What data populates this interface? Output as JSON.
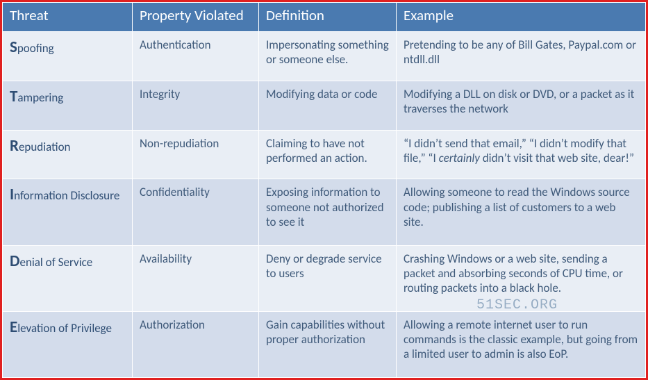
{
  "headers": {
    "threat": "Threat",
    "property": "Property Violated",
    "definition": "Definition",
    "example": "Example"
  },
  "rows": [
    {
      "threat_cap": "S",
      "threat_rest": "poofing",
      "property": "Authentication",
      "definition": "Impersonating something or someone else.",
      "example": "Pretending to be any of Bill Gates, Paypal.com or ntdll.dll"
    },
    {
      "threat_cap": "T",
      "threat_rest": "ampering",
      "property": "Integrity",
      "definition": "Modifying data or code",
      "example": "Modifying a DLL on disk or DVD, or a packet as it traverses the network"
    },
    {
      "threat_cap": "R",
      "threat_rest": "epudiation",
      "property": "Non-repudiation",
      "definition": "Claiming to have not performed an action.",
      "example_pre": "“I didn’t send that email,” “I didn’t modify that file,” “I ",
      "example_italic": "certainly",
      "example_post": " didn’t visit that web site, dear!”"
    },
    {
      "threat_cap": "I",
      "threat_rest": "nformation Disclosure",
      "property": "Confidentiality",
      "definition": "Exposing information to someone not authorized to see it",
      "example": "Allowing someone to read the Windows source code; publishing a list of customers to a web site."
    },
    {
      "threat_cap": "D",
      "threat_rest": "enial of Service",
      "property": "Availability",
      "definition": "Deny or degrade service to users",
      "example": "Crashing Windows or a web site, sending a packet and absorbing seconds of CPU time, or routing packets into a black hole."
    },
    {
      "threat_cap": "E",
      "threat_rest": "levation of Privilege",
      "property": "Authorization",
      "definition": "Gain capabilities without proper authorization",
      "example": "Allowing a remote internet user to run commands is the classic example, but going from a limited user to admin is also EoP."
    }
  ],
  "watermark": "51SEC.ORG"
}
